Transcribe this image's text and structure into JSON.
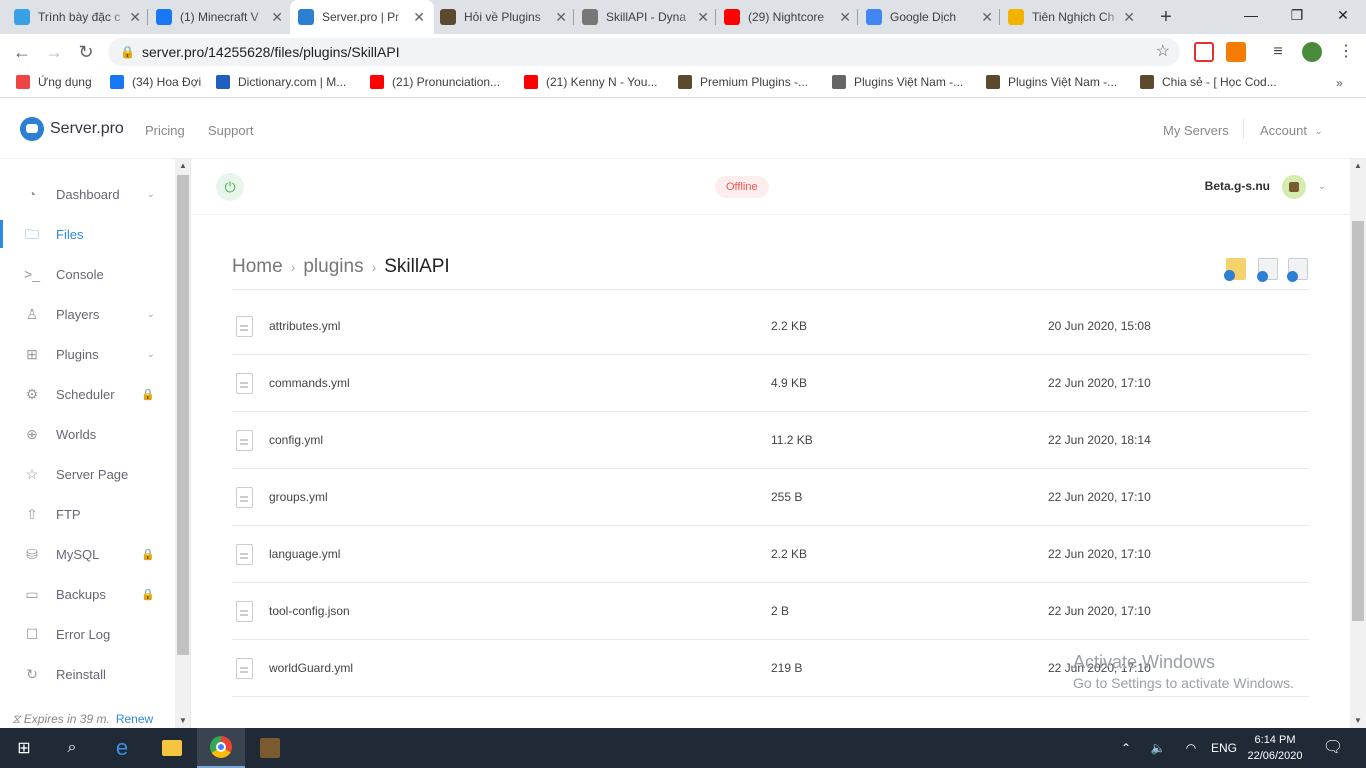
{
  "browser": {
    "tabs": [
      {
        "title": "Trình bày đặc c",
        "favicon": "pinwheel-icon",
        "color": "#3aa0e6",
        "active": false
      },
      {
        "title": "(1) Minecraft V",
        "favicon": "facebook-icon",
        "color": "#1877f2",
        "active": false
      },
      {
        "title": "Server.pro | Pr",
        "favicon": "serverpro-icon",
        "color": "#2d7fd3",
        "active": true
      },
      {
        "title": "Hỏi về Plugins",
        "favicon": "minecraft-block-icon",
        "color": "#5b4a2e",
        "active": false
      },
      {
        "title": "SkillAPI - Dyna",
        "favicon": "globe-icon",
        "color": "#777777",
        "active": false
      },
      {
        "title": "(29) Nightcore",
        "favicon": "youtube-icon",
        "color": "#ff0000",
        "active": false
      },
      {
        "title": "Google Dịch",
        "favicon": "google-translate-icon",
        "color": "#4285f4",
        "active": false
      },
      {
        "title": "Tiên Nghịch Ch",
        "favicon": "n-logo-icon",
        "color": "#f0b400",
        "active": false
      }
    ],
    "url": "server.pro/14255628/files/plugins/SkillAPI",
    "bookmarks": [
      {
        "label": "Ứng dụng",
        "icon": "apps-grid-icon",
        "color": "#e44"
      },
      {
        "label": "(34) Hoa Đợi",
        "icon": "facebook-icon",
        "color": "#1877f2"
      },
      {
        "label": "Dictionary.com | M...",
        "icon": "dictionary-icon",
        "color": "#1f5fbf"
      },
      {
        "label": "(21) Pronunciation...",
        "icon": "youtube-icon",
        "color": "#ff0000"
      },
      {
        "label": "(21) Kenny N - You...",
        "icon": "youtube-icon",
        "color": "#ff0000"
      },
      {
        "label": "Premium Plugins -...",
        "icon": "minecraft-block-icon",
        "color": "#5b4a2e"
      },
      {
        "label": "Plugins Việt Nam -...",
        "icon": "globe-icon",
        "color": "#666"
      },
      {
        "label": "Plugins Việt Nam -...",
        "icon": "minecraft-block-icon",
        "color": "#5b4a2e"
      },
      {
        "label": "Chia sẻ - [ Học Cod...",
        "icon": "minecraft-block-icon",
        "color": "#5b4a2e"
      }
    ]
  },
  "site": {
    "logo": "Server.pro",
    "nav": {
      "pricing": "Pricing",
      "support": "Support",
      "my_servers": "My Servers",
      "account": "Account"
    },
    "accent": "#2d8ae0"
  },
  "sidebar": {
    "items": [
      {
        "label": "Dashboard",
        "icon": "dashboard-icon",
        "glyph": "◔",
        "chevron": true,
        "locked": false,
        "active": false
      },
      {
        "label": "Files",
        "icon": "folder-icon",
        "glyph": "🗀",
        "chevron": false,
        "locked": false,
        "active": true
      },
      {
        "label": "Console",
        "icon": "console-icon",
        "glyph": ">_",
        "chevron": false,
        "locked": false,
        "active": false
      },
      {
        "label": "Players",
        "icon": "user-icon",
        "glyph": "♙",
        "chevron": true,
        "locked": false,
        "active": false
      },
      {
        "label": "Plugins",
        "icon": "plugin-icon",
        "glyph": "⊞",
        "chevron": true,
        "locked": false,
        "active": false
      },
      {
        "label": "Scheduler",
        "icon": "scheduler-icon",
        "glyph": "⚙",
        "chevron": false,
        "locked": true,
        "active": false
      },
      {
        "label": "Worlds",
        "icon": "globe-icon",
        "glyph": "⊕",
        "chevron": false,
        "locked": false,
        "active": false
      },
      {
        "label": "Server Page",
        "icon": "star-icon",
        "glyph": "☆",
        "chevron": false,
        "locked": false,
        "active": false
      },
      {
        "label": "FTP",
        "icon": "upload-icon",
        "glyph": "⇧",
        "chevron": false,
        "locked": false,
        "active": false
      },
      {
        "label": "MySQL",
        "icon": "database-icon",
        "glyph": "⛁",
        "chevron": false,
        "locked": true,
        "active": false
      },
      {
        "label": "Backups",
        "icon": "backup-icon",
        "glyph": "▭",
        "chevron": false,
        "locked": true,
        "active": false
      },
      {
        "label": "Error Log",
        "icon": "error-log-icon",
        "glyph": "☐",
        "chevron": false,
        "locked": false,
        "active": false
      },
      {
        "label": "Reinstall",
        "icon": "reinstall-icon",
        "glyph": "↻",
        "chevron": false,
        "locked": false,
        "active": false
      }
    ],
    "expires_text": "Expires in 39 m.",
    "renew_label": "Renew"
  },
  "server": {
    "status": "Offline",
    "name": "Beta.g-s.nu"
  },
  "breadcrumb": [
    "Home",
    "plugins",
    "SkillAPI"
  ],
  "files": [
    {
      "name": "attributes.yml",
      "size": "2.2 KB",
      "date": "20 Jun 2020, 15:08"
    },
    {
      "name": "commands.yml",
      "size": "4.9 KB",
      "date": "22 Jun 2020, 17:10"
    },
    {
      "name": "config.yml",
      "size": "11.2 KB",
      "date": "22 Jun 2020, 18:14"
    },
    {
      "name": "groups.yml",
      "size": "255 B",
      "date": "22 Jun 2020, 17:10"
    },
    {
      "name": "language.yml",
      "size": "2.2 KB",
      "date": "22 Jun 2020, 17:10"
    },
    {
      "name": "tool-config.json",
      "size": "2 B",
      "date": "22 Jun 2020, 17:10"
    },
    {
      "name": "worldGuard.yml",
      "size": "219 B",
      "date": "22 Jun 2020, 17:10"
    }
  ],
  "watermark": {
    "line1": "Activate Windows",
    "line2": "Go to Settings to activate Windows."
  },
  "taskbar": {
    "language": "ENG",
    "time": "6:14 PM",
    "date": "22/06/2020"
  }
}
